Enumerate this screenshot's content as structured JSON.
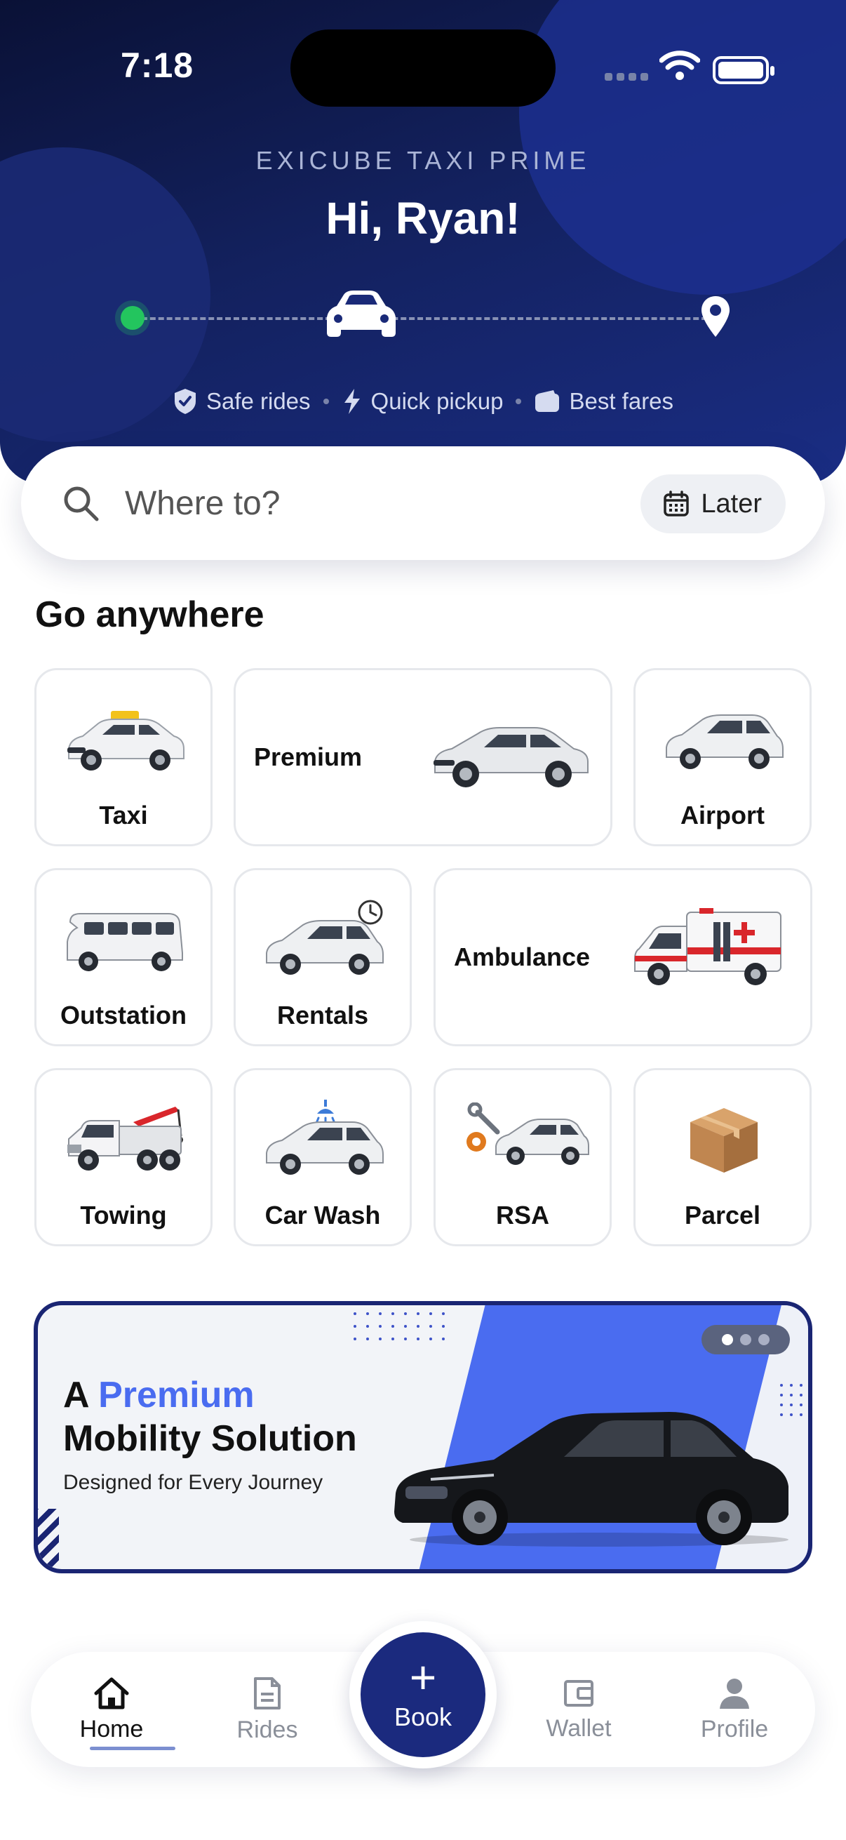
{
  "status_bar": {
    "time": "7:18"
  },
  "header": {
    "brand": "EXICUBE TAXI PRIME",
    "greeting": "Hi, Ryan!",
    "features": [
      {
        "icon": "shield-icon",
        "label": "Safe rides"
      },
      {
        "icon": "bolt-icon",
        "label": "Quick pickup"
      },
      {
        "icon": "wallet-icon",
        "label": "Best fares"
      }
    ]
  },
  "search": {
    "placeholder": "Where to?",
    "schedule_label": "Later"
  },
  "services": {
    "title": "Go anywhere",
    "items": [
      {
        "label": "Taxi",
        "icon": "taxi-car-icon"
      },
      {
        "label": "Premium",
        "icon": "sedan-icon"
      },
      {
        "label": "Airport",
        "icon": "hatchback-icon"
      },
      {
        "label": "Outstation",
        "icon": "van-icon"
      },
      {
        "label": "Rentals",
        "icon": "rental-car-clock-icon"
      },
      {
        "label": "Ambulance",
        "icon": "ambulance-icon"
      },
      {
        "label": "Towing",
        "icon": "tow-truck-icon"
      },
      {
        "label": "Car Wash",
        "icon": "car-wash-icon"
      },
      {
        "label": "RSA",
        "icon": "roadside-assist-icon"
      },
      {
        "label": "Parcel",
        "icon": "parcel-box-icon"
      }
    ]
  },
  "banner": {
    "line1_prefix": "A",
    "line1_accent": "Premium",
    "line2": "Mobility Solution",
    "line3": "Designed for Every Journey",
    "pages": 3,
    "current_page": 1,
    "accent_color": "#4a6cf0"
  },
  "tabbar": {
    "items": [
      {
        "label": "Home",
        "icon": "home-icon",
        "active": true
      },
      {
        "label": "Rides",
        "icon": "document-icon",
        "active": false
      },
      {
        "label": "Book",
        "icon": "plus-icon",
        "active": false
      },
      {
        "label": "Wallet",
        "icon": "wallet-icon",
        "active": false
      },
      {
        "label": "Profile",
        "icon": "person-icon",
        "active": false
      }
    ]
  },
  "colors": {
    "primary": "#1b2a7e",
    "header_dark": "#0a1136",
    "success": "#23c55e"
  }
}
